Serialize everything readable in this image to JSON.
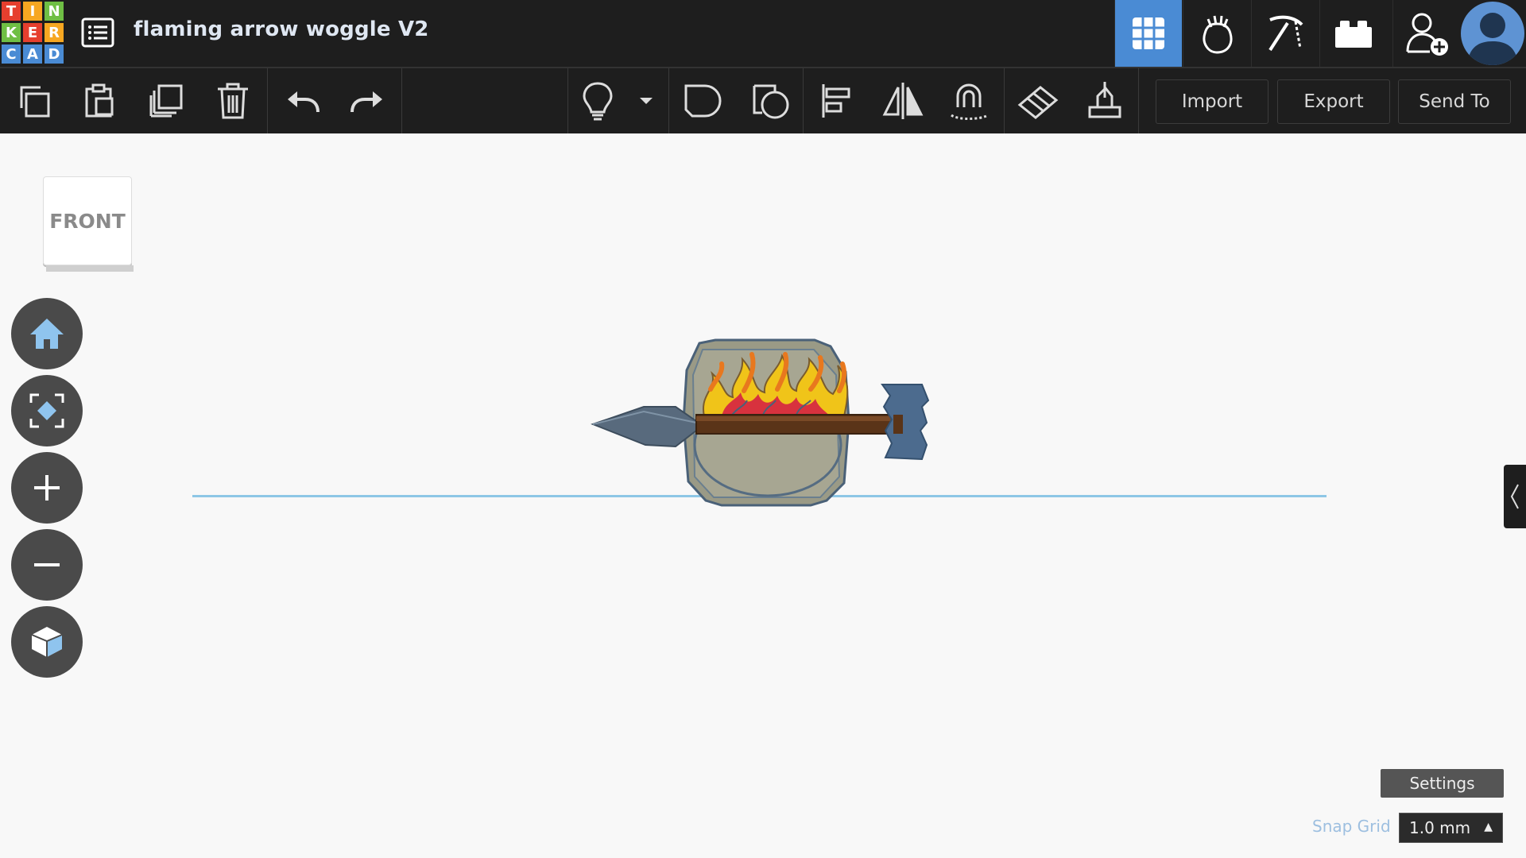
{
  "app": {
    "logo_letters": [
      "T",
      "I",
      "N",
      "K",
      "E",
      "R",
      "C",
      "A",
      "D"
    ],
    "logo_colors": [
      "#e63f2e",
      "#f7a721",
      "#6fbf44",
      "#6fbf44",
      "#e63f2e",
      "#f7a721",
      "#4a8bd4",
      "#4a8bd4",
      "#4a8bd4"
    ],
    "project_title": "flaming arrow woggle V2"
  },
  "modes": [
    {
      "name": "3d-design",
      "icon": "grid-icon",
      "active": true
    },
    {
      "name": "codeblocks",
      "icon": "cat-blocks-icon",
      "active": false
    },
    {
      "name": "minecraft",
      "icon": "pickaxe-icon",
      "active": false
    },
    {
      "name": "lego-bricks",
      "icon": "brick-icon",
      "active": false
    },
    {
      "name": "invite",
      "icon": "add-user-icon",
      "active": false
    }
  ],
  "toolbar": {
    "edit_tools": [
      "copy-icon",
      "paste-icon",
      "duplicate-icon",
      "delete-icon",
      "undo-icon",
      "redo-icon"
    ],
    "shape_tools": [
      "bulb-icon",
      "group-icon",
      "ungroup-icon",
      "align-icon",
      "mirror-icon",
      "cruise-icon",
      "workplane-icon",
      "ruler-icon"
    ],
    "import_label": "Import",
    "export_label": "Export",
    "send_label": "Send To"
  },
  "view": {
    "viewcube_label": "FRONT",
    "nav_buttons": [
      "home-view-icon",
      "fit-view-icon",
      "zoom-in-icon",
      "zoom-out-icon",
      "perspective-icon"
    ]
  },
  "bottom": {
    "settings_label": "Settings",
    "snap_label": "Snap Grid",
    "snap_value": "1.0 mm"
  },
  "colors": {
    "accent": "#4a8bd4",
    "bar_bg": "#1e1e1e",
    "workplane_bg": "#f8f8f8",
    "ground_line": "#8ec7e6"
  }
}
